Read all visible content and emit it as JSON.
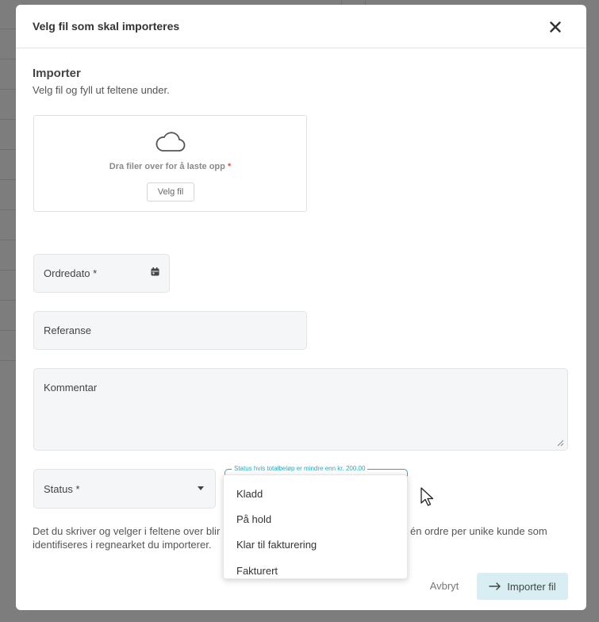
{
  "modal": {
    "title": "Velg fil som skal importeres",
    "close_icon": "close-icon"
  },
  "import_section": {
    "title": "Importer",
    "subtitle": "Velg fil og fyll ut feltene under."
  },
  "upload": {
    "icon": "cloud-icon",
    "drop_text": "Dra filer over for å laste opp",
    "required_mark": "*",
    "choose_button": "Velg fil"
  },
  "fields": {
    "order_date": {
      "label": "Ordredato *",
      "icon": "calendar-icon"
    },
    "reference": {
      "label": "Referanse"
    },
    "comment": {
      "label": "Kommentar"
    },
    "status": {
      "label": "Status *",
      "icon": "chevron-down-icon"
    },
    "status_below_total": {
      "label": "Status hvis totalbeløp er mindre enn kr. 200.00"
    }
  },
  "info": {
    "text_left": "Det du skriver og velger i feltene over blir",
    "text_right": "én ordre per unike kunde som",
    "text_line2": "identifiseres i regnearket du importerer."
  },
  "dropdown": {
    "options": [
      "Kladd",
      "På hold",
      "Klar til fakturering",
      "Fakturert"
    ]
  },
  "footer": {
    "cancel": "Avbryt",
    "import": "Importer fil",
    "import_icon": "arrow-right-icon"
  },
  "colors": {
    "accent": "#2aa8b8",
    "import_button_bg": "#d8eef3",
    "required": "#d9534f"
  }
}
